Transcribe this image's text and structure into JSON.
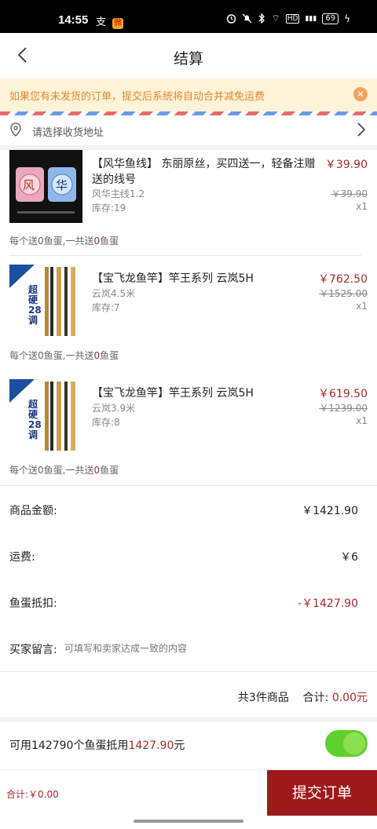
{
  "status_bar": {
    "time": "14:55",
    "app_glyph": "支",
    "weibo_glyph": "微",
    "right_icons": [
      "alarm-icon",
      "mute-icon",
      "bluetooth-icon",
      "wifi-icon",
      "hd-icon",
      "signal-icon"
    ],
    "battery": "69",
    "wifi_symbol": "⌔",
    "hd": "HD",
    "signal": "▮▮▮",
    "bolt": "ϟ"
  },
  "nav": {
    "title": "结算"
  },
  "notice": {
    "text": "如果您有未发货的订单，提交后系统将自动合并减免运费",
    "close_symbol": "✕"
  },
  "address": {
    "placeholder": "请选择收货地址"
  },
  "products": [
    {
      "name": "【风华鱼线】 东丽原丝，买四送一，轻备注赠送的线号",
      "spec": "风华主线1.2",
      "stock": "库存:19",
      "price": "￥39.90",
      "old_price": "￥39.90",
      "qty": "x1",
      "note_prefix": "每个送0鱼蛋,一共送",
      "note_count": "0",
      "note_suffix": "鱼蛋",
      "thumb_text_1": "风",
      "thumb_text_2": "华"
    },
    {
      "name": "【宝飞龙鱼竿】竿王系列 云岚5H",
      "spec": "云岚4.5米",
      "stock": "库存:7",
      "price": "￥762.50",
      "old_price": "￥1525.00",
      "qty": "x1",
      "note_prefix": "每个送0鱼蛋,一共送",
      "note_count": "0",
      "note_suffix": "鱼蛋",
      "thumb_text_1": "超硬28调"
    },
    {
      "name": "【宝飞龙鱼竿】竿王系列 云岚5H",
      "spec": "云岚3.9米",
      "stock": "库存:8",
      "price": "￥619.50",
      "old_price": "￥1239.00",
      "qty": "x1",
      "note_prefix": "每个送0鱼蛋,一共送",
      "note_count": "0",
      "note_suffix": "鱼蛋",
      "thumb_text_1": "超硬28调"
    }
  ],
  "summary": {
    "goods_label": "商品金额:",
    "goods_value": "￥1421.90",
    "shipping_label": "运费:",
    "shipping_value": "￥6",
    "discount_label": "鱼蛋抵扣:",
    "discount_value": "-￥1427.90",
    "message_label": "买家留言:",
    "message_placeholder": "可填写和卖家达成一致的内容",
    "count_text": "共3件商品",
    "total_label": "合计:",
    "total_value": "0.00元"
  },
  "coins": {
    "prefix": "可用142790个鱼蛋抵用",
    "amount": "1427.90",
    "suffix": "元",
    "enabled": true
  },
  "bottom": {
    "sum_text": "合计:￥0.00",
    "submit_label": "提交订单"
  },
  "colors": {
    "accent": "#9e1a1a",
    "price": "#a52a2a",
    "toggle_on": "#5fd12c",
    "notice_bg": "#fdf3d8",
    "notice_text": "#e08a2a"
  }
}
